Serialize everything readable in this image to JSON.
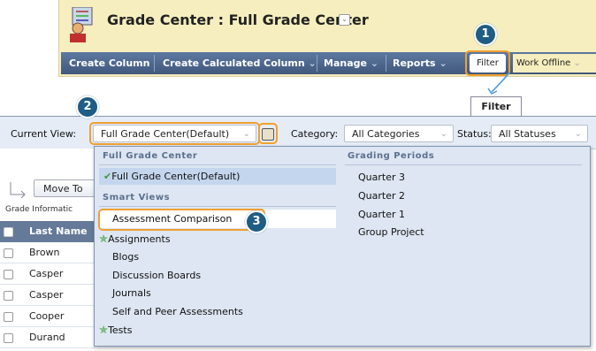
{
  "header": {
    "title": "Grade Center : Full Grade Center",
    "toolbar": {
      "create_column": "Create Column",
      "create_calculated_column": "Create Calculated Column",
      "manage": "Manage",
      "reports": "Reports",
      "filter": "Filter",
      "work_offline": "Work Offline"
    }
  },
  "callouts": {
    "one": "1",
    "two": "2",
    "three": "3"
  },
  "filter_tab": "Filter",
  "filter_bar": {
    "current_view_label": "Current View:",
    "current_view_value": "Full Grade Center(Default)",
    "category_label": "Category:",
    "category_value": "All Categories",
    "status_label": "Status:",
    "status_value": "All Statuses"
  },
  "background_grid": {
    "move_to": "Move To",
    "grade_information": "Grade Informatic",
    "last_name": "Last Name",
    "rows": [
      "Brown",
      "Casper",
      "Casper",
      "Cooper",
      "Durand"
    ]
  },
  "dropdown": {
    "full_grade_center_heading": "Full Grade Center",
    "full_grade_center_item": "Full Grade Center(Default)",
    "smart_views_heading": "Smart Views",
    "smart_views": [
      "Assessment Comparison",
      "Assignments",
      "Blogs",
      "Discussion Boards",
      "Journals",
      "Self and Peer Assessments",
      "Tests"
    ],
    "grading_periods_heading": "Grading Periods",
    "grading_periods": [
      "Quarter 3",
      "Quarter 2",
      "Quarter 1",
      "Group Project"
    ]
  },
  "colors": {
    "toolbar": "#4d6690",
    "highlight": "#f0a030",
    "badge": "#1f5d84",
    "header_bg": "#f6eebe",
    "panel_bg": "#dde6f2"
  }
}
